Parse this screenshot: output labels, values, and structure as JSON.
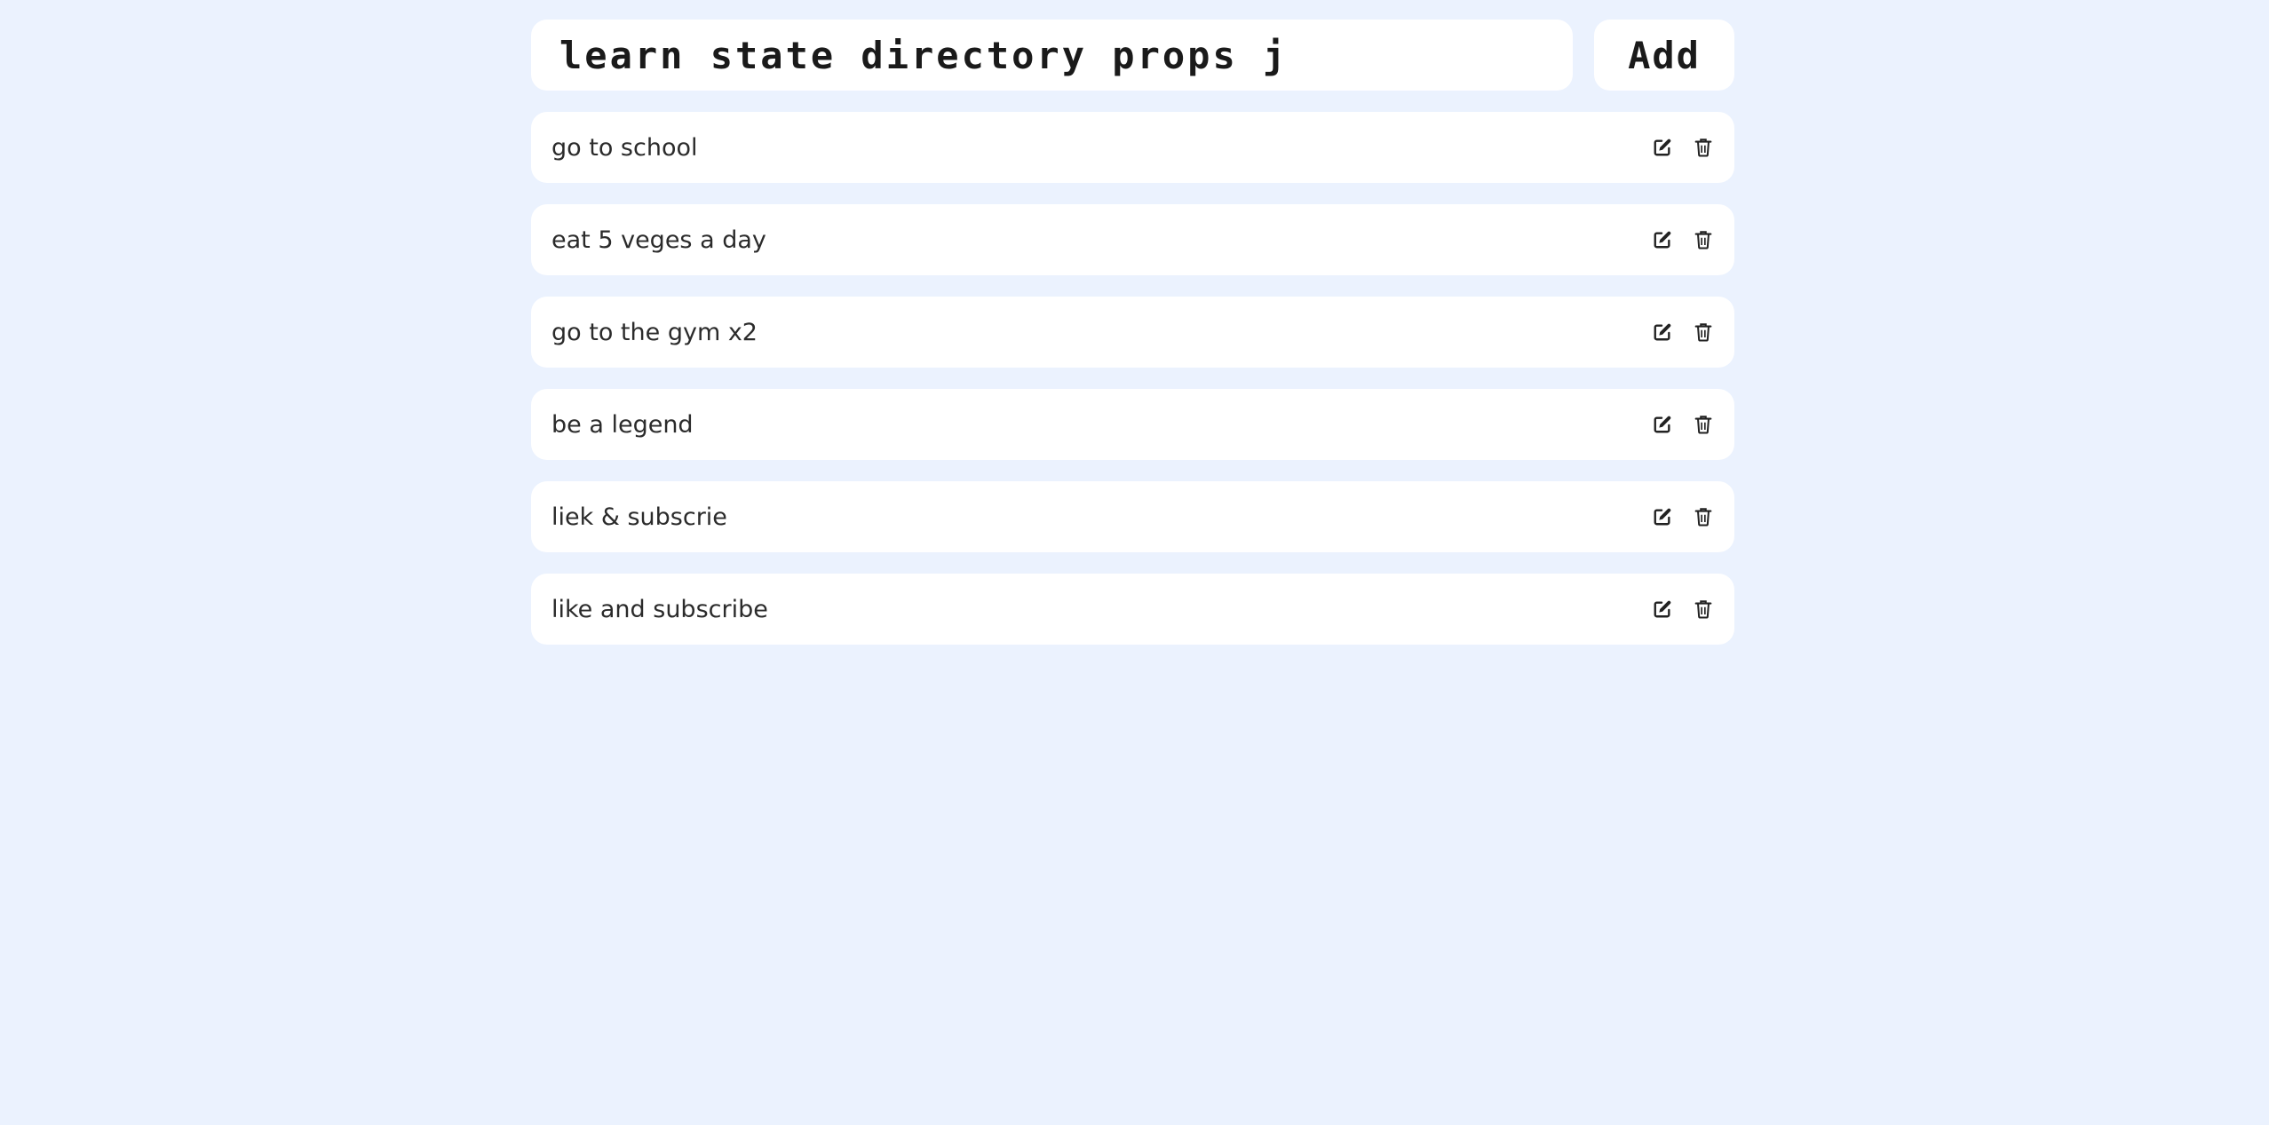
{
  "new_todo": {
    "value": "learn state directory props j",
    "add_label": "Add"
  },
  "todos": [
    {
      "text": "go to school",
      "edit_icon": "edit-icon",
      "delete_icon": "trash-icon"
    },
    {
      "text": "eat 5 veges a day",
      "edit_icon": "edit-icon",
      "delete_icon": "trash-icon"
    },
    {
      "text": "go to the gym x2",
      "edit_icon": "edit-icon",
      "delete_icon": "trash-icon"
    },
    {
      "text": "be a legend",
      "edit_icon": "edit-icon",
      "delete_icon": "trash-icon"
    },
    {
      "text": "liek & subscrie",
      "edit_icon": "edit-icon",
      "delete_icon": "trash-icon"
    },
    {
      "text": "like and subscribe",
      "edit_icon": "edit-icon",
      "delete_icon": "trash-icon"
    }
  ],
  "colors": {
    "background": "#ebf2fe",
    "card": "#ffffff",
    "text": "#2b2b2b"
  }
}
